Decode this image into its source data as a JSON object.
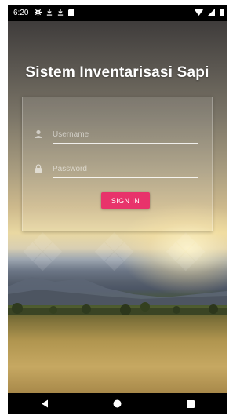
{
  "status_bar": {
    "time": "6:20",
    "left_icons": [
      "settings-icon",
      "download-icon",
      "download-icon",
      "sd-card-icon"
    ],
    "right_icons": [
      "wifi-icon",
      "signal-icon",
      "battery-icon"
    ]
  },
  "app": {
    "title": "Sistem Inventarisasi Sapi"
  },
  "login": {
    "username_placeholder": "Username",
    "password_placeholder": "Password",
    "username_value": "",
    "password_value": "",
    "sign_in_label": "SIGN IN"
  },
  "colors": {
    "accent": "#e8336b",
    "text": "#ffffff"
  },
  "navigation": {
    "buttons": [
      "back-icon",
      "home-icon",
      "recents-icon"
    ]
  }
}
